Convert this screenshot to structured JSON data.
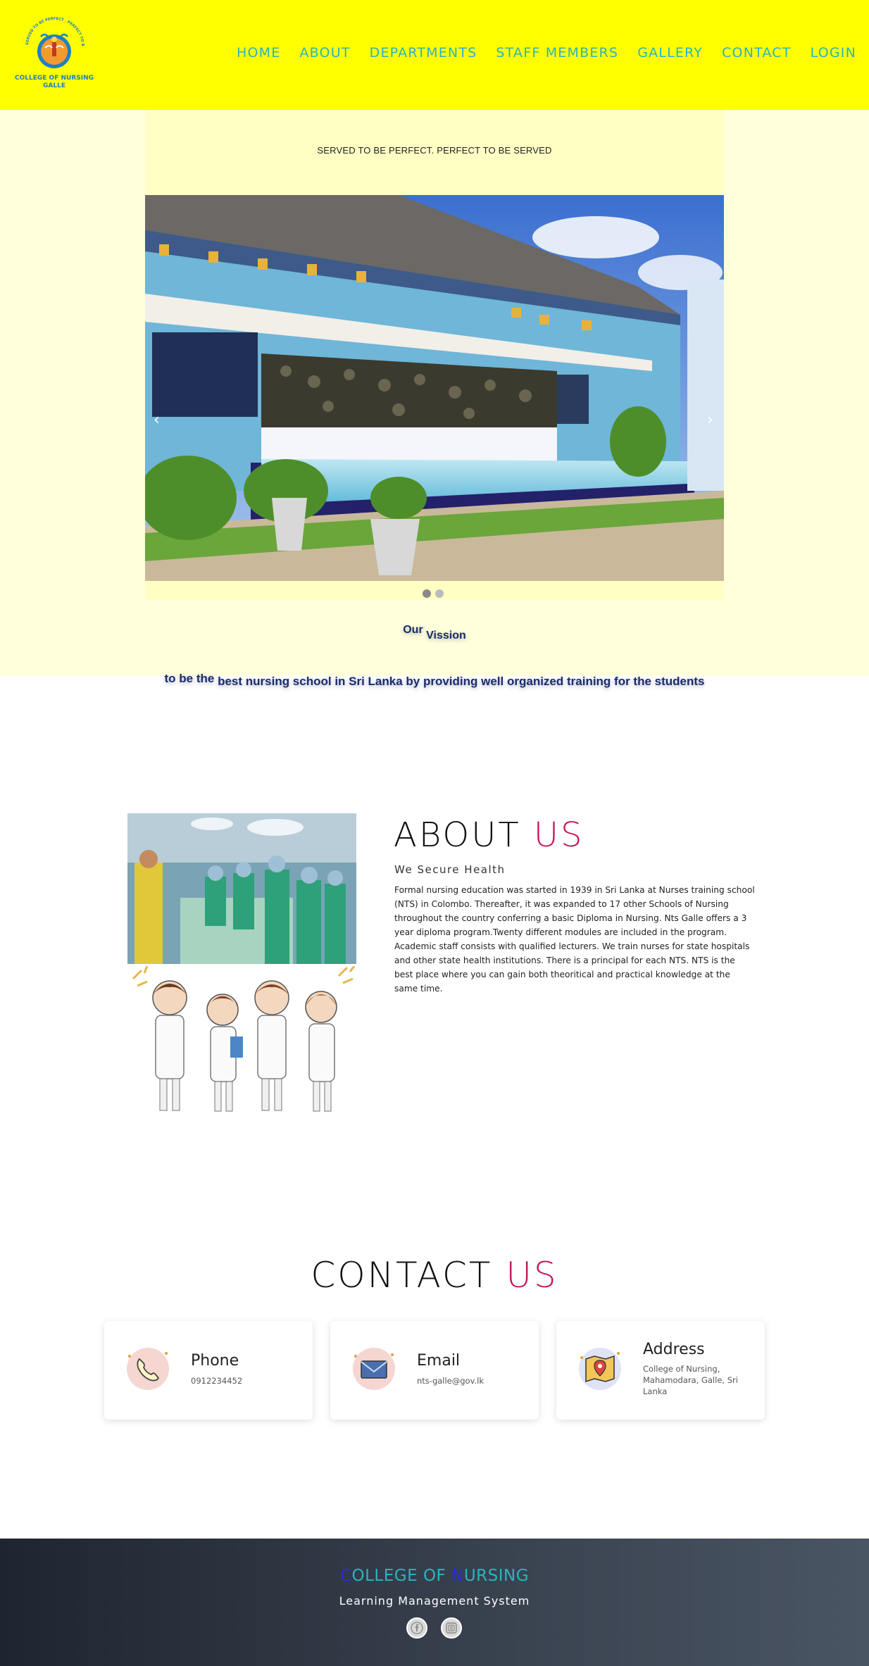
{
  "logo": {
    "arc_text": "SERVED TO BE PERFECT . PERFECT TO BE SERVED",
    "name_line1": "COLLEGE OF NURSING",
    "name_line2": "GALLE",
    "icon": "college-crest-logo"
  },
  "nav": {
    "items": [
      "HOME",
      "ABOUT",
      "DEPARTMENTS",
      "STAFF MEMBERS",
      "GALLERY",
      "CONTACT",
      "LOGIN"
    ],
    "color": "#2bb3c0"
  },
  "hero": {
    "tagline": "SERVED TO BE PERFECT. PERFECT TO BE SERVED",
    "prev_arrow": "‹",
    "next_arrow": "›",
    "active_slide": 1,
    "slide_count": 2
  },
  "vision": {
    "title_word1": "Our",
    "title_word2": "Vission",
    "text_part1": "to be the",
    "text_part2": "best nursing school in Sri Lanka by providing well organized training for the students"
  },
  "about": {
    "heading_main": "ABOUT",
    "heading_accent": "US",
    "subtitle": "We Secure Health",
    "body": "Formal nursing education was started in 1939 in Sri Lanka at Nurses training school (NTS) in Colombo. Thereafter, it was expanded to 17 other Schools of Nursing throughout the country conferring a basic Diploma in Nursing. Nts Galle offers a 3 year diploma program.Twenty different modules are included in the program. Academic staff consists with qualified lecturers. We train nurses for state hospitals and other state health institutions. There is a principal for each NTS. NTS is the best place where you can gain both theoritical and practical knowledge at the same time."
  },
  "contact": {
    "heading_main": "CONTACT",
    "heading_accent": "US",
    "cards": [
      {
        "title": "Phone",
        "value": "0912234452",
        "icon": "phone-icon"
      },
      {
        "title": "Email",
        "value": "nts-galle@gov.lk",
        "icon": "email-icon"
      },
      {
        "title": "Address",
        "value": "College of Nursing, Mahamodara, Galle, Sri Lanka",
        "icon": "map-icon"
      }
    ]
  },
  "footer": {
    "title_c": "C",
    "title_rest1": "OLLEGE OF ",
    "title_n": "N",
    "title_rest2": "URSING",
    "subtitle": "Learning Management System",
    "social": [
      "facebook-icon",
      "instagram-icon"
    ]
  },
  "colors": {
    "navbar": "#ffff00",
    "hero_bg": "#ffffdc",
    "accent": "#c2185b",
    "vision_text": "#1a2c6b"
  }
}
